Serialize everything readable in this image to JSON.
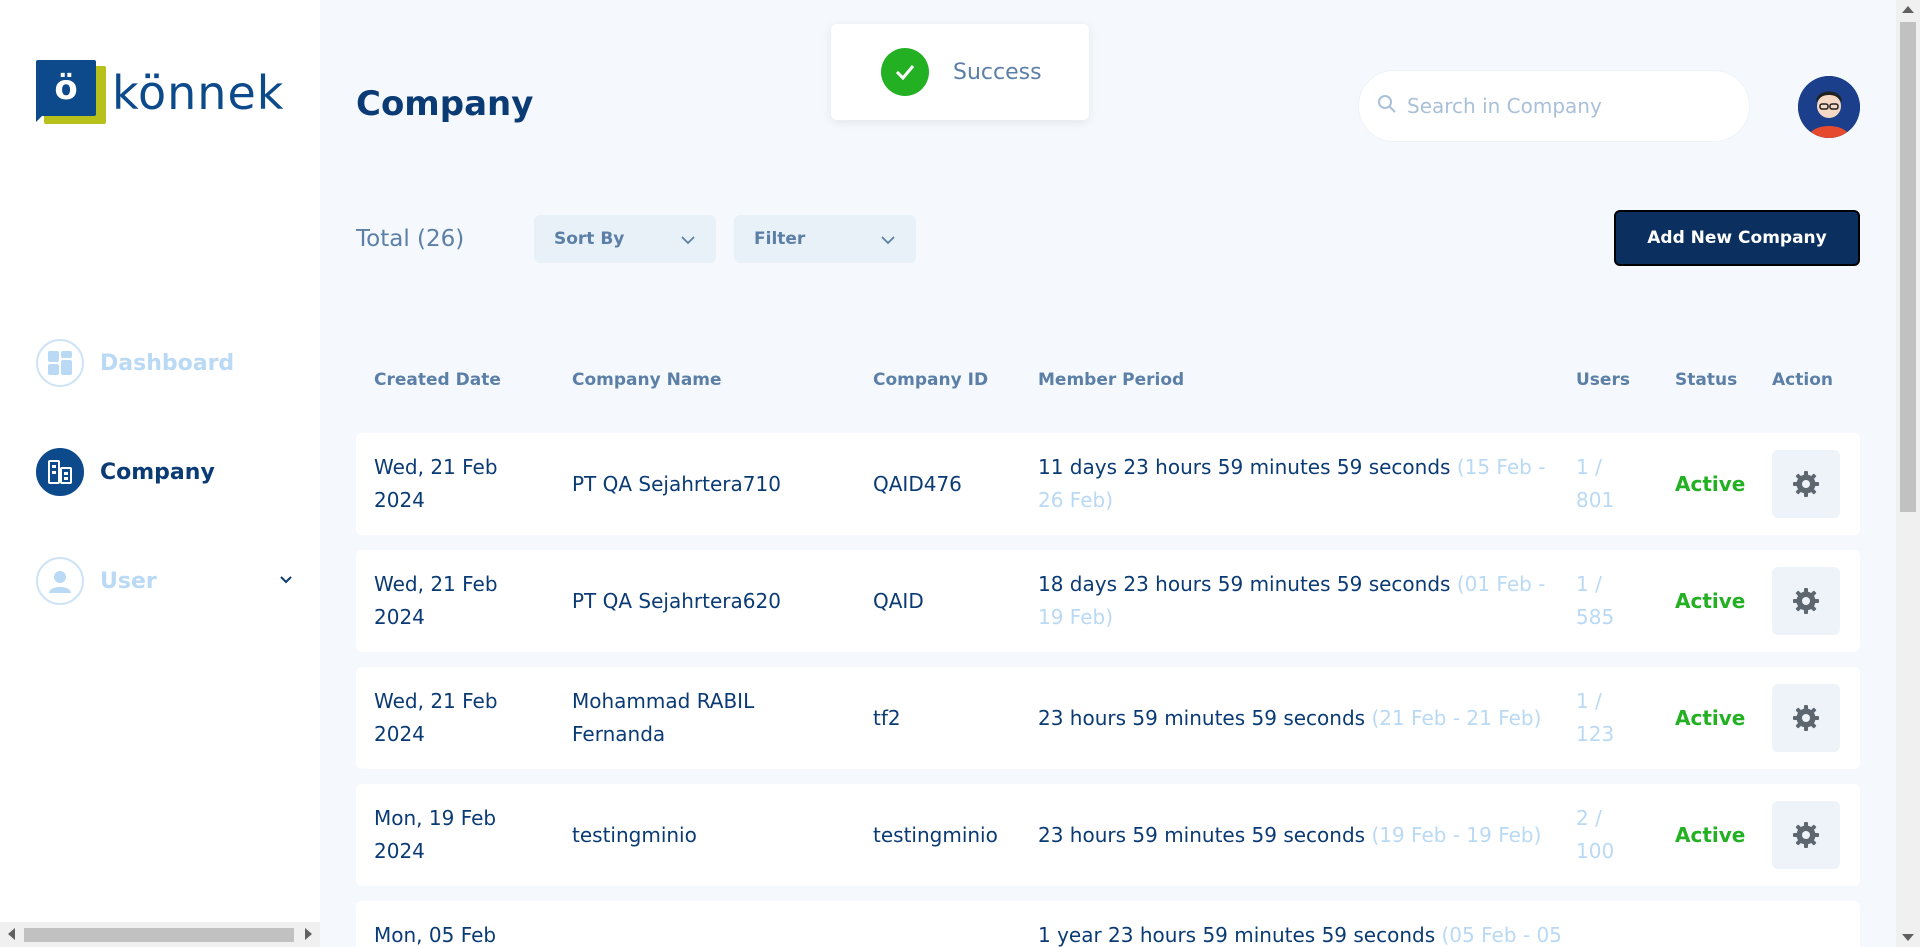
{
  "brand": {
    "name": "könnek",
    "mark_letter": "ö"
  },
  "nav": [
    {
      "label": "Dashboard",
      "icon": "dashboard-icon",
      "active": false
    },
    {
      "label": "Company",
      "icon": "company-icon",
      "active": true
    },
    {
      "label": "User",
      "icon": "user-icon",
      "active": false
    }
  ],
  "page": {
    "title": "Company"
  },
  "toast": {
    "text": "Success"
  },
  "search": {
    "placeholder": "Search in Company",
    "value": ""
  },
  "toolbar": {
    "total": "Total (26)",
    "sort_label": "Sort By",
    "filter_label": "Filter",
    "add_label": "Add New Company"
  },
  "table": {
    "headers": {
      "created": "Created Date",
      "name": "Company Name",
      "id": "Company ID",
      "period": "Member Period",
      "users": "Users",
      "status": "Status",
      "action": "Action"
    },
    "rows": [
      {
        "created": "Wed, 21 Feb 2024",
        "name": "PT QA Sejahrtera710",
        "id": "QAID476",
        "period": "11 days 23 hours 59 minutes 59 seconds",
        "range": "(15 Feb - 26 Feb)",
        "users": "1 / 801",
        "status": "Active"
      },
      {
        "created": "Wed, 21 Feb 2024",
        "name": "PT QA Sejahrtera620",
        "id": "QAID",
        "period": "18 days 23 hours 59 minutes 59 seconds",
        "range": "(01 Feb - 19 Feb)",
        "users": "1 / 585",
        "status": "Active"
      },
      {
        "created": "Wed, 21 Feb 2024",
        "name": "Mohammad RABIL Fernanda",
        "id": "tf2",
        "period": "23 hours 59 minutes 59 seconds",
        "range": "(21 Feb - 21 Feb)",
        "users": "1 / 123",
        "status": "Active"
      },
      {
        "created": "Mon, 19 Feb 2024",
        "name": "testingminio",
        "id": "testingminio",
        "period": "23 hours 59 minutes 59 seconds",
        "range": "(19 Feb - 19 Feb)",
        "users": "2 / 100",
        "status": "Active"
      },
      {
        "created": "Mon, 05 Feb",
        "name": "",
        "id": "",
        "period": "1 year 23 hours 59 minutes 59 seconds",
        "range": "(05 Feb - 05",
        "users": "",
        "status": ""
      }
    ]
  },
  "colors": {
    "primary": "#0b3b75",
    "accent": "#0d4a8c",
    "success": "#23b023",
    "muted": "#b9d9f4",
    "background": "#f5f9fd"
  }
}
